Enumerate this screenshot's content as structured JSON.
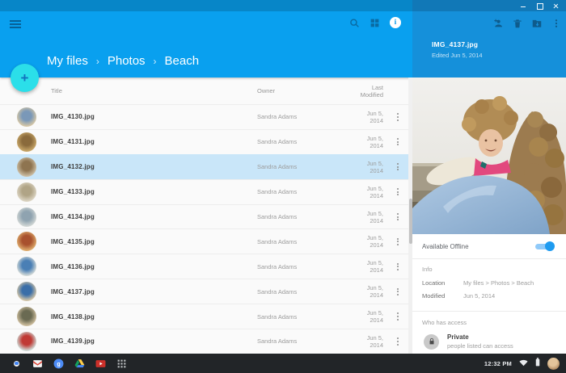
{
  "window": {
    "controls": [
      "minimize",
      "maximize",
      "close"
    ]
  },
  "toolbar": {
    "breadcrumb": [
      "My files",
      "Photos",
      "Beach"
    ],
    "separator": "›",
    "icons": [
      "menu-icon",
      "search-icon",
      "grid-view-icon",
      "info-icon"
    ],
    "fab_plus": "+"
  },
  "files": {
    "columns": {
      "title": "Title",
      "owner": "Owner",
      "modified": "Last Modified"
    },
    "rows": [
      {
        "name": "IMG_4130.jpg",
        "owner": "Sandra Adams",
        "modified": "Jun 5, 2014",
        "selected": false,
        "thumb": {
          "outer": "#D8C8A6",
          "inner": "#7A98B8"
        }
      },
      {
        "name": "IMG_4131.jpg",
        "owner": "Sandra Adams",
        "modified": "Jun 5, 2014",
        "selected": false,
        "thumb": {
          "outer": "#C9A86A",
          "inner": "#8A6A3C"
        }
      },
      {
        "name": "IMG_4132.jpg",
        "owner": "Sandra Adams",
        "modified": "Jun 5, 2014",
        "selected": true,
        "thumb": {
          "outer": "#CDBFA5",
          "inner": "#8E7450"
        }
      },
      {
        "name": "IMG_4133.jpg",
        "owner": "Sandra Adams",
        "modified": "Jun 5, 2014",
        "selected": false,
        "thumb": {
          "outer": "#DDD6C5",
          "inner": "#B0A486"
        }
      },
      {
        "name": "IMG_4134.jpg",
        "owner": "Sandra Adams",
        "modified": "Jun 5, 2014",
        "selected": false,
        "thumb": {
          "outer": "#D3D8D6",
          "inner": "#8FA3B0"
        }
      },
      {
        "name": "IMG_4135.jpg",
        "owner": "Sandra Adams",
        "modified": "Jun 5, 2014",
        "selected": false,
        "thumb": {
          "outer": "#DFAE6E",
          "inner": "#A8512E"
        }
      },
      {
        "name": "IMG_4136.jpg",
        "owner": "Sandra Adams",
        "modified": "Jun 5, 2014",
        "selected": false,
        "thumb": {
          "outer": "#D5DBD8",
          "inner": "#4A7FB5"
        }
      },
      {
        "name": "IMG_4137.jpg",
        "owner": "Sandra Adams",
        "modified": "Jun 5, 2014",
        "selected": false,
        "thumb": {
          "outer": "#D8C8A8",
          "inner": "#3A6EA8"
        }
      },
      {
        "name": "IMG_4138.jpg",
        "owner": "Sandra Adams",
        "modified": "Jun 5, 2014",
        "selected": false,
        "thumb": {
          "outer": "#D0C0A0",
          "inner": "#6A6A52"
        }
      },
      {
        "name": "IMG_4139.jpg",
        "owner": "Sandra Adams",
        "modified": "Jun 5, 2014",
        "selected": false,
        "thumb": {
          "outer": "#CFE0DC",
          "inner": "#C03A35"
        }
      }
    ]
  },
  "details": {
    "title": "IMG_4137.jpg",
    "subtitle": "Edited Jun 5, 2014",
    "header_icons": [
      "person-add-icon",
      "delete-icon",
      "move-to-folder-icon",
      "more-vert-icon"
    ],
    "offline_label": "Available Offline",
    "offline_on": true,
    "info_label": "Info",
    "location_label": "Location",
    "location_value": "My files > Photos > Beach",
    "modified_label": "Modified",
    "modified_value": "Jun 5, 2014",
    "access_label": "Who has access",
    "access_name": "Private",
    "access_desc": "people listed can access"
  },
  "shelf": {
    "apps": [
      "Chrome",
      "Gmail",
      "Google",
      "Google Drive",
      "YouTube",
      "Apps"
    ],
    "time": "12:32 PM",
    "status_icons": [
      "wifi-icon",
      "battery-icon",
      "user-avatar"
    ]
  },
  "colors": {
    "header_left": "#09A0EF",
    "header_right": "#1590DA",
    "selected_row": "#C9E6F9",
    "fab": "#2BDFE9",
    "toggle_on": "#1E9BF0",
    "shelf_bg": "#222528"
  }
}
